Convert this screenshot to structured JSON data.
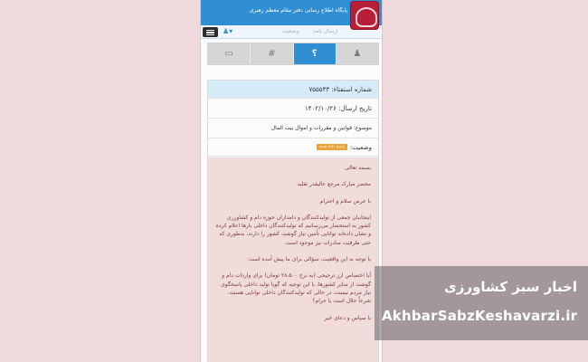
{
  "header": {
    "site_title": "پایگاه اطلاع رسانی دفتر مقام معظم رهبری",
    "logo_icon": "leader-office-logo-icon",
    "color": "#2f8fd2"
  },
  "navbar": {
    "send_label": "ارسال نامه",
    "status_label": "وضعیت",
    "user_icon": "user-icon",
    "menu_icon": "hamburger-menu-icon"
  },
  "tabs": [
    {
      "icon": "users-icon",
      "glyph": "♟",
      "active": false
    },
    {
      "icon": "question-icon",
      "glyph": "؟",
      "active": true
    },
    {
      "icon": "hash-icon",
      "glyph": "#",
      "active": false
    },
    {
      "icon": "card-icon",
      "glyph": "▭",
      "active": false
    }
  ],
  "inquiry": {
    "number_label": "شماره استفتاء: ۷۵۵۵۴۳",
    "date_label": "تاریخ ارسال: ۱۴۰۲/۱۰/۲۶",
    "subject_label": "موضوع: قوانین و مقررات و اموال بیت المال",
    "status_label": "وضعیت:",
    "status_badge": "پاسخ داده شده",
    "badge_color": "#e8a33c"
  },
  "message": {
    "line1": "بسمه تعالی",
    "line2": "محضر مبارک مرجع عالیقدر تقلید",
    "line3": "با عرض سلام و احترام",
    "paragraph1": "اینجانبان جمعی از تولیدکنندگان و دامداران حوزه دام و کشاورزی کشور به استحضار می‌رسانیم که تولیدکنندگان داخلی بارها اعلام کرده و نشان داده‌اند توانایی تأمین نیاز گوشت کشور را دارند، به‌طوری که حتی ظرفیت صادرات نیز موجود است.",
    "paragraph2": "با توجه به این واقعیت، سؤالی برای ما پیش آمده است:",
    "paragraph3": "آیا اختصاص ارز ترجیحی (به نرخ ۲۸،۵۰۰ تومان) برای واردات دام و گوشت از سایر کشورها، با این توجیه که گویا تولید داخلی پاسخگوی نیاز مردم نیست، در حالی که تولیدکنندگان داخلی توانایی هستند، شرعاً حلال است یا حرام؟",
    "closing": "با سپاس و دعای خیر"
  },
  "watermark": {
    "title": "اخبار سبز کشاورزی",
    "url": "AkhbarSabzKeshavarzi.ir"
  }
}
